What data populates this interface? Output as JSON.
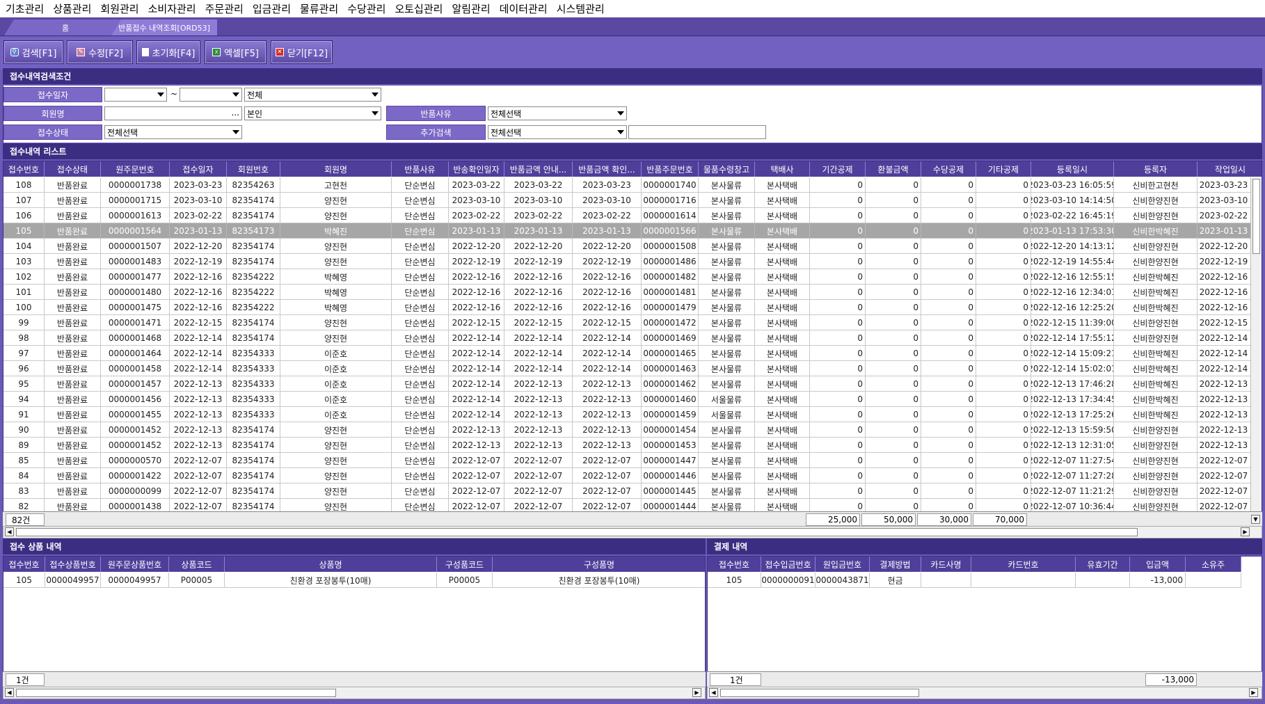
{
  "menu": [
    "기초관리",
    "상품관리",
    "회원관리",
    "소비자관리",
    "주문관리",
    "입금관리",
    "물류관리",
    "수당관리",
    "오토십관리",
    "알림관리",
    "데이터관리",
    "시스템관리"
  ],
  "tabs": {
    "home": "홈",
    "active": "반품접수 내역조회[ORD53]"
  },
  "toolbar": {
    "search": "검색[F1]",
    "edit": "수정[F2]",
    "reset": "초기화[F4]",
    "excel": "엑셀[F5]",
    "close": "닫기[F12]"
  },
  "search": {
    "title": "접수내역검색조건",
    "date_label": "접수일자",
    "date_from": "",
    "date_tilde": "~",
    "date_to": "",
    "date_type": "전체",
    "member_label": "회원명",
    "member_value": "",
    "member_dots": "...",
    "member_scope": "본인",
    "reason_label": "반품사유",
    "reason_value": "전체선택",
    "status_label": "접수상태",
    "status_value": "전체선택",
    "extra_label": "추가검색",
    "extra_value": "전체선택",
    "extra_text": ""
  },
  "list": {
    "title": "접수내역 리스트",
    "columns": [
      "접수번호",
      "접수상태",
      "원주문번호",
      "접수일자",
      "회원번호",
      "회원명",
      "반품사유",
      "반송확인일자",
      "반품금액 안내...",
      "반품금액 확인...",
      "반품주문번호",
      "물품수령창고",
      "택배사",
      "기간공제",
      "환불금액",
      "수당공제",
      "기타공제",
      "등록일시",
      "등록자",
      "작업일시"
    ],
    "rows": [
      [
        "108",
        "반품완료",
        "0000001738",
        "2023-03-23",
        "82354263",
        "고현천",
        "단순변심",
        "2023-03-22",
        "2023-03-22",
        "2023-03-23",
        "0000001740",
        "본사물류",
        "본사택배",
        "0",
        "0",
        "0",
        "0",
        "2023-03-23 16:05:59",
        "신비한고현천",
        "2023-03-23 16"
      ],
      [
        "107",
        "반품완료",
        "0000001715",
        "2023-03-10",
        "82354174",
        "양진현",
        "단순변심",
        "2023-03-10",
        "2023-03-10",
        "2023-03-10",
        "0000001716",
        "본사물류",
        "본사택배",
        "0",
        "0",
        "0",
        "0",
        "2023-03-10 14:14:50",
        "신비한양진현",
        "2023-03-10 14"
      ],
      [
        "106",
        "반품완료",
        "0000001613",
        "2023-02-22",
        "82354174",
        "양진현",
        "단순변심",
        "2023-02-22",
        "2023-02-22",
        "2023-02-22",
        "0000001614",
        "본사물류",
        "본사택배",
        "0",
        "0",
        "0",
        "0",
        "2023-02-22 16:45:19",
        "신비한양진현",
        "2023-02-22 16"
      ],
      [
        "105",
        "반품완료",
        "0000001564",
        "2023-01-13",
        "82354173",
        "박혜진",
        "단순변심",
        "2023-01-13",
        "2023-01-13",
        "2023-01-13",
        "0000001566",
        "본사물류",
        "본사택배",
        "0",
        "0",
        "0",
        "0",
        "2023-01-13 17:53:30",
        "신비한박혜진",
        "2023-01-13 17"
      ],
      [
        "104",
        "반품완료",
        "0000001507",
        "2022-12-20",
        "82354174",
        "양진현",
        "단순변심",
        "2022-12-20",
        "2022-12-20",
        "2022-12-20",
        "0000001508",
        "본사물류",
        "본사택배",
        "0",
        "0",
        "0",
        "0",
        "2022-12-20 14:13:12",
        "신비한양진현",
        "2022-12-20 14"
      ],
      [
        "103",
        "반품완료",
        "0000001483",
        "2022-12-19",
        "82354174",
        "양진현",
        "단순변심",
        "2022-12-19",
        "2022-12-19",
        "2022-12-19",
        "0000001486",
        "본사물류",
        "본사택배",
        "0",
        "0",
        "0",
        "0",
        "2022-12-19 14:55:44",
        "신비한양진현",
        "2022-12-19 14"
      ],
      [
        "102",
        "반품완료",
        "0000001477",
        "2022-12-16",
        "82354222",
        "박혜영",
        "단순변심",
        "2022-12-16",
        "2022-12-16",
        "2022-12-16",
        "0000001482",
        "본사물류",
        "본사택배",
        "0",
        "0",
        "0",
        "0",
        "2022-12-16 12:55:15",
        "신비한박혜진",
        "2022-12-16 12"
      ],
      [
        "101",
        "반품완료",
        "0000001480",
        "2022-12-16",
        "82354222",
        "박혜영",
        "단순변심",
        "2022-12-16",
        "2022-12-16",
        "2022-12-16",
        "0000001481",
        "본사물류",
        "본사택배",
        "0",
        "0",
        "0",
        "0",
        "2022-12-16 12:34:01",
        "신비한박혜진",
        "2022-12-16 12"
      ],
      [
        "100",
        "반품완료",
        "0000001475",
        "2022-12-16",
        "82354222",
        "박혜영",
        "단순변심",
        "2022-12-16",
        "2022-12-16",
        "2022-12-16",
        "0000001479",
        "본사물류",
        "본사택배",
        "0",
        "0",
        "0",
        "0",
        "2022-12-16 12:25:20",
        "신비한박혜진",
        "2022-12-16 12"
      ],
      [
        "99",
        "반품완료",
        "0000001471",
        "2022-12-15",
        "82354174",
        "양진현",
        "단순변심",
        "2022-12-15",
        "2022-12-15",
        "2022-12-15",
        "0000001472",
        "본사물류",
        "본사택배",
        "0",
        "0",
        "0",
        "0",
        "2022-12-15 11:39:00",
        "신비한양진현",
        "2022-12-15 11"
      ],
      [
        "98",
        "반품완료",
        "0000001468",
        "2022-12-14",
        "82354174",
        "양진현",
        "단순변심",
        "2022-12-14",
        "2022-12-14",
        "2022-12-14",
        "0000001469",
        "본사물류",
        "본사택배",
        "0",
        "0",
        "0",
        "0",
        "2022-12-14 17:55:12",
        "신비한양진현",
        "2022-12-14 17"
      ],
      [
        "97",
        "반품완료",
        "0000001464",
        "2022-12-14",
        "82354333",
        "이준호",
        "단순변심",
        "2022-12-14",
        "2022-12-14",
        "2022-12-14",
        "0000001465",
        "본사물류",
        "본사택배",
        "0",
        "0",
        "0",
        "0",
        "2022-12-14 15:09:21",
        "신비한박혜진",
        "2022-12-14 15"
      ],
      [
        "96",
        "반품완료",
        "0000001458",
        "2022-12-14",
        "82354333",
        "이준호",
        "단순변심",
        "2022-12-14",
        "2022-12-14",
        "2022-12-14",
        "0000001463",
        "본사물류",
        "본사택배",
        "0",
        "0",
        "0",
        "0",
        "2022-12-14 15:02:01",
        "신비한박혜진",
        "2022-12-14 15"
      ],
      [
        "95",
        "반품완료",
        "0000001457",
        "2022-12-13",
        "82354333",
        "이준호",
        "단순변심",
        "2022-12-14",
        "2022-12-13",
        "2022-12-13",
        "0000001462",
        "본사물류",
        "본사택배",
        "0",
        "0",
        "0",
        "0",
        "2022-12-13 17:46:28",
        "신비한박혜진",
        "2022-12-13 17"
      ],
      [
        "94",
        "반품완료",
        "0000001456",
        "2022-12-13",
        "82354333",
        "이준호",
        "단순변심",
        "2022-12-14",
        "2022-12-13",
        "2022-12-13",
        "0000001460",
        "서울물류",
        "본사택배",
        "0",
        "0",
        "0",
        "0",
        "2022-12-13 17:34:45",
        "신비한박혜진",
        "2022-12-13 17"
      ],
      [
        "91",
        "반품완료",
        "0000001455",
        "2022-12-13",
        "82354333",
        "이준호",
        "단순변심",
        "2022-12-14",
        "2022-12-13",
        "2022-12-13",
        "0000001459",
        "서울물류",
        "본사택배",
        "0",
        "0",
        "0",
        "0",
        "2022-12-13 17:25:26",
        "신비한박혜진",
        "2022-12-13 17"
      ],
      [
        "90",
        "반품완료",
        "0000001452",
        "2022-12-13",
        "82354174",
        "양진현",
        "단순변심",
        "2022-12-13",
        "2022-12-13",
        "2022-12-13",
        "0000001454",
        "본사물류",
        "본사택배",
        "0",
        "0",
        "0",
        "0",
        "2022-12-13 15:59:50",
        "신비한양진현",
        "2022-12-13 15"
      ],
      [
        "89",
        "반품완료",
        "0000001452",
        "2022-12-13",
        "82354174",
        "양진현",
        "단순변심",
        "2022-12-13",
        "2022-12-13",
        "2022-12-13",
        "0000001453",
        "본사물류",
        "본사택배",
        "0",
        "0",
        "0",
        "0",
        "2022-12-13 12:31:05",
        "신비한양진현",
        "2022-12-13 12"
      ],
      [
        "85",
        "반품완료",
        "0000000570",
        "2022-12-07",
        "82354174",
        "양진현",
        "단순변심",
        "2022-12-07",
        "2022-12-07",
        "2022-12-07",
        "0000001447",
        "본사물류",
        "본사택배",
        "0",
        "0",
        "0",
        "0",
        "2022-12-07 11:27:54",
        "신비한양진현",
        "2022-12-07 11"
      ],
      [
        "84",
        "반품완료",
        "0000001422",
        "2022-12-07",
        "82354174",
        "양진현",
        "단순변심",
        "2022-12-07",
        "2022-12-07",
        "2022-12-07",
        "0000001446",
        "본사물류",
        "본사택배",
        "0",
        "0",
        "0",
        "0",
        "2022-12-07 11:27:28",
        "신비한양진현",
        "2022-12-07 11"
      ],
      [
        "83",
        "반품완료",
        "0000000099",
        "2022-12-07",
        "82354174",
        "양진현",
        "단순변심",
        "2022-12-07",
        "2022-12-07",
        "2022-12-07",
        "0000001445",
        "본사물류",
        "본사택배",
        "0",
        "0",
        "0",
        "0",
        "2022-12-07 11:21:29",
        "신비한양진현",
        "2022-12-07 11"
      ],
      [
        "82",
        "반품완료",
        "0000001438",
        "2022-12-07",
        "82354174",
        "양진현",
        "단순변심",
        "2022-12-07",
        "2022-12-07",
        "2022-12-07",
        "0000001444",
        "본사물류",
        "본사택배",
        "0",
        "0",
        "0",
        "0",
        "2022-12-07 10:36:44",
        "신비한양진현",
        "2022-12-07 10"
      ]
    ],
    "selected_index": 3,
    "footer": {
      "count": "82건",
      "t1": "25,000",
      "t2": "50,000",
      "t3": "30,000",
      "t4": "70,000"
    }
  },
  "product": {
    "title": "접수 상품 내역",
    "columns": [
      "접수번호",
      "접수상품번호",
      "원주문상품번호",
      "상품코드",
      "상품명",
      "구성품코드",
      "구성품명"
    ],
    "rows": [
      [
        "105",
        "0000049957",
        "0000049957",
        "P00005",
        "친환경 포장봉투(10매)",
        "P00005",
        "친환경 포장봉투(10매)"
      ]
    ],
    "footer": {
      "count": "1건"
    }
  },
  "payment": {
    "title": "결제 내역",
    "columns": [
      "접수번호",
      "접수입금번호",
      "원입금번호",
      "결제방법",
      "카드사명",
      "카드번호",
      "유효기간",
      "입금액",
      "소유주"
    ],
    "rows": [
      [
        "105",
        "0000000091",
        "0000043871",
        "현금",
        "",
        "",
        "",
        "-13,000",
        ""
      ]
    ],
    "footer": {
      "count": "1건",
      "total": "-13,000"
    }
  },
  "colors": {
    "purple": "#6c59b5",
    "header": "#4f3f9a",
    "section": "#3b2e82",
    "selected_row": "#a6a6a6"
  },
  "icons": [
    "search-icon",
    "edit-icon",
    "document-icon",
    "excel-icon",
    "close-icon",
    "dropdown-arrow-icon"
  ]
}
